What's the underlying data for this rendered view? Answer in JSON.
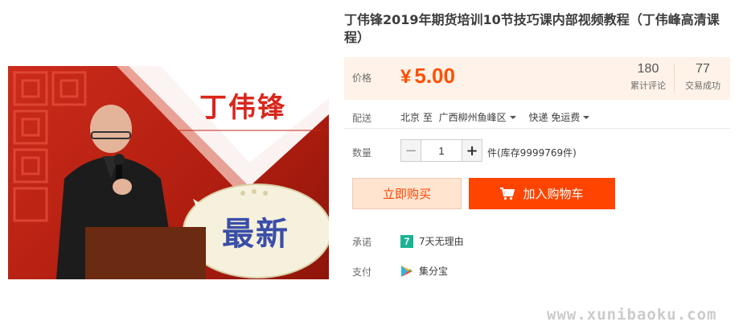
{
  "product": {
    "title": "丁伟锋2019年期货培训10节技巧课内部视频教程（丁伟峰高清课程）",
    "corner_mark": "",
    "image": {
      "title_text": "丁伟锋",
      "badge_text": "最新"
    }
  },
  "price": {
    "label": "价格",
    "currency": "¥",
    "value": "5.00",
    "reviews_count": "180",
    "reviews_label": "累计评论",
    "deals_count": "77",
    "deals_label": "交易成功"
  },
  "delivery": {
    "label": "配送",
    "from_text": "北京 至",
    "destination": "广西柳州鱼峰区",
    "shipping": "快递 免运费"
  },
  "quantity": {
    "label": "数量",
    "minus": "−",
    "value": "1",
    "plus": "+",
    "stock_text": "件(库存9999769件)"
  },
  "actions": {
    "buy_now": "立即购买",
    "add_to_cart": "加入购物车"
  },
  "promise": {
    "label": "承诺",
    "icon_text": "7",
    "text": "7天无理由"
  },
  "payment": {
    "label": "支付",
    "text": "集分宝"
  },
  "watermark": "www.xunibaoku.com",
  "colors": {
    "accent": "#ff4400",
    "price": "#ff5000",
    "price_panel_bg": "#fff2e8",
    "buy_bg": "#ffe4d0"
  },
  "icons": {
    "cart": "shopping-cart-icon",
    "caret": "chevron-down-icon",
    "promise": "seven-days-icon",
    "payment": "jifenbao-icon"
  }
}
